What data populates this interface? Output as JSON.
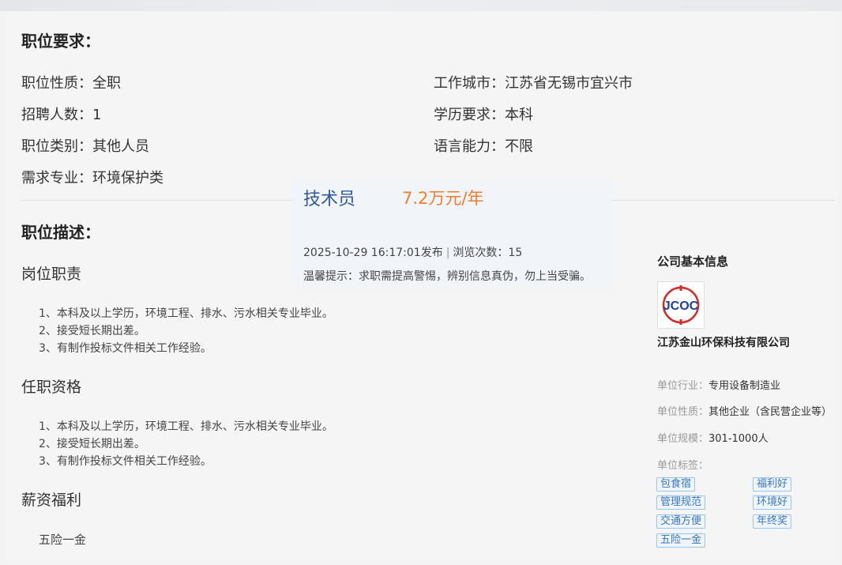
{
  "requirements": {
    "title": "职位要求：",
    "left": [
      {
        "label": "职位性质：",
        "value": "全职"
      },
      {
        "label": "招聘人数：",
        "value": "1"
      },
      {
        "label": "职位类别：",
        "value": "其他人员"
      },
      {
        "label": "需求专业：",
        "value": "环境保护类"
      }
    ],
    "right": [
      {
        "label": "工作城市：",
        "value": "江苏省无锡市宜兴市"
      },
      {
        "label": "学历要求：",
        "value": "本科"
      },
      {
        "label": "语言能力：",
        "value": "不限"
      }
    ]
  },
  "description": {
    "title": "职位描述：",
    "duties_title": "岗位职责",
    "duties": [
      "1、本科及以上学历，环境工程、排水、污水相关专业毕业。",
      "2、接受短长期出差。",
      "3、有制作投标文件相关工作经验。"
    ],
    "qualifications_title": "任职资格",
    "qualifications": [
      "1、本科及以上学历，环境工程、排水、污水相关专业毕业。",
      "2、接受短长期出差。",
      "3、有制作投标文件相关工作经验。"
    ],
    "benefits_title": "薪资福利",
    "benefits_text": "五险一金"
  },
  "job_header": {
    "title": "技术员",
    "salary": "7.2万元/年",
    "published": "2025-10-29 16:17:01发布",
    "separator": "|",
    "views": "浏览次数：15",
    "warning": "温馨提示：求职需提高警惕，辨别信息真伪，勿上当受骗。"
  },
  "company": {
    "heading": "公司基本信息",
    "logo_text": "JCOC",
    "name": "江苏金山环保科技有限公司",
    "industry_label": "单位行业：",
    "industry": "专用设备制造业",
    "nature_label": "单位性质：",
    "nature": "其他企业（含民营企业等）",
    "scale_label": "单位规模：",
    "scale": "301-1000人",
    "tags_label": "单位标签：",
    "tags": [
      "包食宿",
      "福利好",
      "管理规范",
      "环境好",
      "交通方便",
      "年终奖",
      "五险一金"
    ]
  },
  "colors": {
    "title_blue": "#2f5aa0",
    "salary_orange": "#f07d2c",
    "tag_blue": "#3a76c4",
    "logo_blue": "#1c3fa8",
    "logo_red": "#d42a2a"
  }
}
